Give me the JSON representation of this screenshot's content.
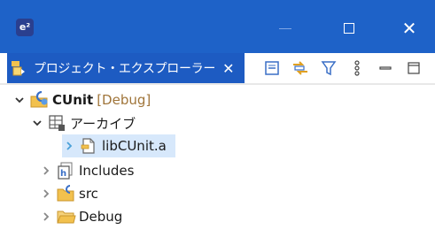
{
  "titlebar": {
    "app_icon_text": "e²",
    "minimize": "—",
    "maximize": "☐",
    "close": "✕"
  },
  "tab": {
    "label": "プロジェクト・エクスプローラー",
    "close": "✕"
  },
  "toolbar": {
    "items": [
      "collapse-all",
      "link-with-editor",
      "filter",
      "view-menu",
      "minimize-view",
      "maximize-view"
    ]
  },
  "tree": {
    "project": {
      "name": "CUnit",
      "decoration": "[Debug]"
    },
    "archives": {
      "name": "アーカイブ"
    },
    "lib": {
      "name": "libCUnit.a"
    },
    "includes": {
      "name": "Includes"
    },
    "src": {
      "name": "src"
    },
    "debug": {
      "name": "Debug"
    }
  },
  "colors": {
    "titlebar": "#1e62c8",
    "tab_active": "#1d5bc2",
    "selection": "#d7e8fb",
    "folder": "#e8b04a",
    "decoration": "#a0753a"
  }
}
